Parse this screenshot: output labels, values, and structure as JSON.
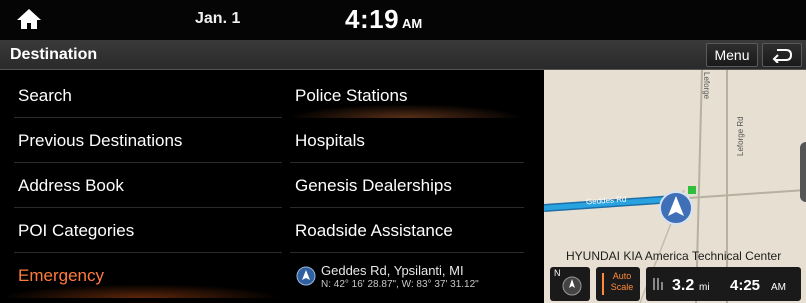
{
  "status": {
    "date": "Jan. 1",
    "time": "4:19",
    "ampm": "AM"
  },
  "header": {
    "title": "Destination",
    "menu_label": "Menu"
  },
  "left_menu": [
    {
      "label": "Search",
      "active": false
    },
    {
      "label": "Previous Destinations",
      "active": false
    },
    {
      "label": "Address Book",
      "active": false
    },
    {
      "label": "POI Categories",
      "active": false
    },
    {
      "label": "Emergency",
      "active": true
    }
  ],
  "sub_menu": [
    {
      "label": "Police Stations",
      "highlight": true
    },
    {
      "label": "Hospitals",
      "highlight": false
    },
    {
      "label": "Genesis Dealerships",
      "highlight": false
    },
    {
      "label": "Roadside Assistance",
      "highlight": false
    }
  ],
  "current_location": {
    "name": "Geddes Rd, Ypsilanti, MI",
    "coordinates": "N: 42° 16' 28.87\", W: 83° 37' 31.12\""
  },
  "map": {
    "road_label_1": "Geddes Rd",
    "road_label_2": "Leforge",
    "road_label_3": "Leforge Rd",
    "poi_label": "HYUNDAI KIA America Technical Center",
    "compass_label": "N",
    "autoscale_line1": "Auto",
    "autoscale_line2": "Scale",
    "distance_value": "3.2",
    "distance_unit": "mi",
    "eta_time": "4:25",
    "eta_ampm": "AM",
    "route_color": "#29a3e0",
    "accent_color": "#ff7a3d"
  }
}
